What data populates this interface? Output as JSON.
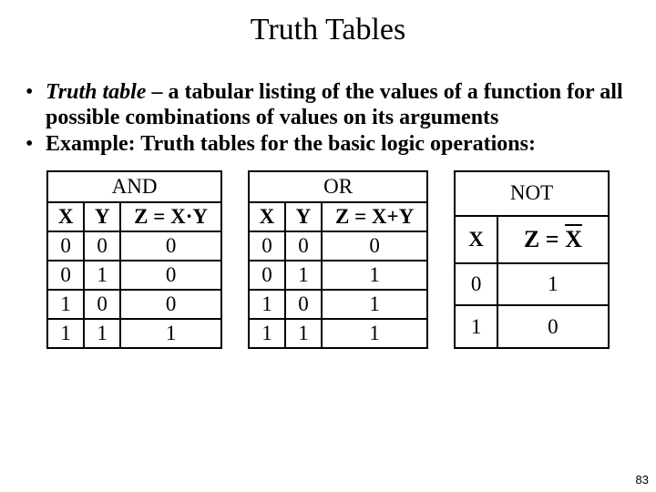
{
  "title": "Truth Tables",
  "bullets": {
    "b1_term": "Truth table",
    "b1_rest": " – a tabular listing of the values of a function for all possible combinations of values on its arguments",
    "b2": "Example: Truth tables for the basic logic operations:"
  },
  "bullet_char": "•",
  "tables": {
    "and": {
      "caption": "AND",
      "headers": [
        "X",
        "Y",
        "Z = X·Y"
      ],
      "rows": [
        [
          "0",
          "0",
          "0"
        ],
        [
          "0",
          "1",
          "0"
        ],
        [
          "1",
          "0",
          "0"
        ],
        [
          "1",
          "1",
          "1"
        ]
      ]
    },
    "or": {
      "caption": "OR",
      "headers": [
        "X",
        "Y",
        "Z = X+Y"
      ],
      "rows": [
        [
          "0",
          "0",
          "0"
        ],
        [
          "0",
          "1",
          "1"
        ],
        [
          "1",
          "0",
          "1"
        ],
        [
          "1",
          "1",
          "1"
        ]
      ]
    },
    "not": {
      "caption": "NOT",
      "headers_x": "X",
      "headers_z_prefix": "Z = ",
      "headers_z_over": "X",
      "rows": [
        [
          "0",
          "1"
        ],
        [
          "1",
          "0"
        ]
      ]
    }
  },
  "page_number": "83",
  "chart_data": [
    {
      "type": "table",
      "title": "AND",
      "columns": [
        "X",
        "Y",
        "Z = X·Y"
      ],
      "rows": [
        [
          0,
          0,
          0
        ],
        [
          0,
          1,
          0
        ],
        [
          1,
          0,
          0
        ],
        [
          1,
          1,
          1
        ]
      ]
    },
    {
      "type": "table",
      "title": "OR",
      "columns": [
        "X",
        "Y",
        "Z = X+Y"
      ],
      "rows": [
        [
          0,
          0,
          0
        ],
        [
          0,
          1,
          1
        ],
        [
          1,
          0,
          1
        ],
        [
          1,
          1,
          1
        ]
      ]
    },
    {
      "type": "table",
      "title": "NOT",
      "columns": [
        "X",
        "Z = NOT X"
      ],
      "rows": [
        [
          0,
          1
        ],
        [
          1,
          0
        ]
      ]
    }
  ]
}
